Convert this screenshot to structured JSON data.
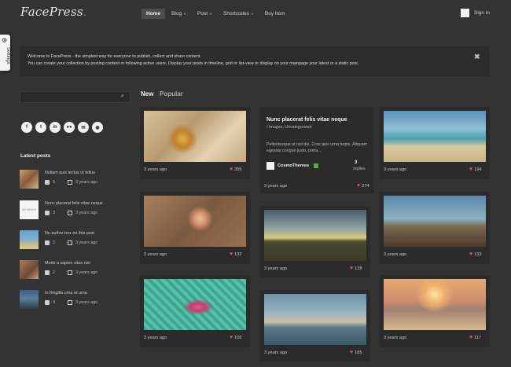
{
  "header": {
    "logo": "FacePress",
    "nav": [
      {
        "label": "Home",
        "active": true,
        "dropdown": false
      },
      {
        "label": "Blog",
        "active": false,
        "dropdown": true
      },
      {
        "label": "Post",
        "active": false,
        "dropdown": true
      },
      {
        "label": "Shortcodes",
        "active": false,
        "dropdown": true
      },
      {
        "label": "Buy Item",
        "active": false,
        "dropdown": false
      }
    ],
    "signin": "Sign in"
  },
  "settings_tab": "Settings",
  "welcome": {
    "line1": "Welcome to FacePress - the simplest way for everyone to publish, collect and share content.",
    "line2": "You can create your collection by posting content or following active users. Display your posts in timeline, grid or list-view or display on your mainpage your latest or a static post.",
    "close_icon": "close-icon"
  },
  "sidebar": {
    "search_placeholder": "",
    "social_icons": [
      "facebook-icon",
      "twitter-icon",
      "linkedin-icon",
      "flickr-icon",
      "email-icon",
      "rss-icon"
    ],
    "latest_title": "Latest posts",
    "latest_posts": [
      {
        "title": "Nullam quis lectus ut tellus",
        "comments": "5",
        "date": "3 years ago"
      },
      {
        "title": "Nunc placerat felis vitae neque",
        "comments": "3",
        "date": "3 years ago",
        "thumb_text": "NO IMAGE"
      },
      {
        "title": "No author box on this post",
        "comments": "2",
        "date": "3 years ago"
      },
      {
        "title": "Morbi a sapien vitae nisi",
        "comments": "2",
        "date": "3 years ago"
      },
      {
        "title": "In fringilla urna et urna",
        "comments": "0",
        "date": "3 years ago"
      }
    ]
  },
  "tabs": {
    "new": "New",
    "popular": "Popular"
  },
  "cards": {
    "c1": {
      "time": "3 years ago",
      "likes": "355"
    },
    "c2": {
      "time": "3 years ago",
      "likes": "132"
    },
    "c3": {
      "time": "3 years ago",
      "likes": "106"
    },
    "text_card": {
      "title": "Nunc placerat felis vitae neque",
      "cats": "/ Images, Uncategorized",
      "body": "Pellentesque at nisl dui. Cras quis urna turpis. Aliquam egestas congue justo, porta...",
      "author": "CosmoThemes",
      "replies_count": "3",
      "replies_label": "replies",
      "time": "3 years ago",
      "likes": "274"
    },
    "c4": {
      "time": "3 years ago",
      "likes": "128"
    },
    "c5": {
      "time": "3 years ago",
      "likes": "185"
    },
    "c6": {
      "time": "3 years ago",
      "likes": "194"
    },
    "c7": {
      "time": "3 years ago",
      "likes": "133"
    },
    "c8": {
      "time": "3 years ago",
      "likes": "117"
    }
  }
}
